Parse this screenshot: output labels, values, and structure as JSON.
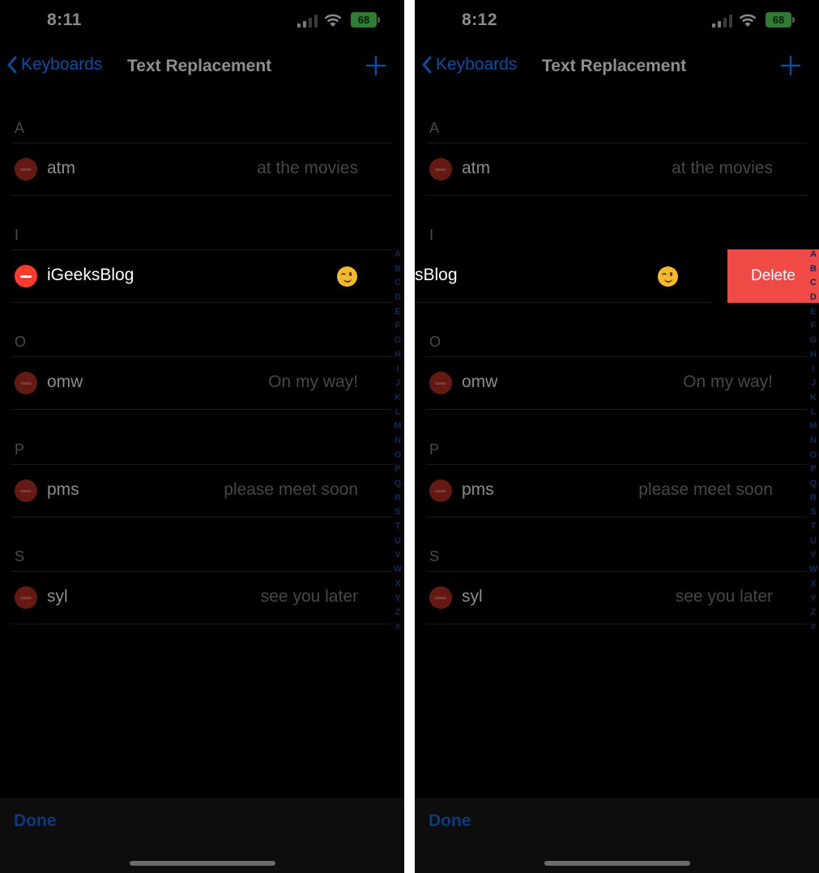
{
  "screens": {
    "left": {
      "time": "8:11",
      "battery": "68"
    },
    "right": {
      "time": "8:12",
      "battery": "68"
    }
  },
  "nav": {
    "back_label": "Keyboards",
    "title": "Text Replacement"
  },
  "sections": [
    {
      "letter": "A",
      "items": [
        {
          "shortcut": "atm",
          "phrase": "at the movies"
        }
      ]
    },
    {
      "letter": "I",
      "items": [
        {
          "shortcut": "iGeeksBlog",
          "phrase": "😉"
        }
      ]
    },
    {
      "letter": "O",
      "items": [
        {
          "shortcut": "omw",
          "phrase": "On my way!"
        }
      ]
    },
    {
      "letter": "P",
      "items": [
        {
          "shortcut": "pms",
          "phrase": "please meet soon"
        }
      ]
    },
    {
      "letter": "S",
      "items": [
        {
          "shortcut": "syl",
          "phrase": "see you later"
        }
      ]
    }
  ],
  "swiped_row": {
    "visible_shortcut": "sBlog",
    "delete_label": "Delete"
  },
  "index_letters": [
    "A",
    "B",
    "C",
    "D",
    "E",
    "F",
    "G",
    "H",
    "I",
    "J",
    "K",
    "L",
    "M",
    "N",
    "O",
    "P",
    "Q",
    "R",
    "S",
    "T",
    "U",
    "V",
    "W",
    "X",
    "Y",
    "Z",
    "#"
  ],
  "toolbar": {
    "done_label": "Done"
  },
  "colors": {
    "accent": "#0a4ea8",
    "delete": "#ef4a45",
    "minus_active": "#ff3b30"
  }
}
